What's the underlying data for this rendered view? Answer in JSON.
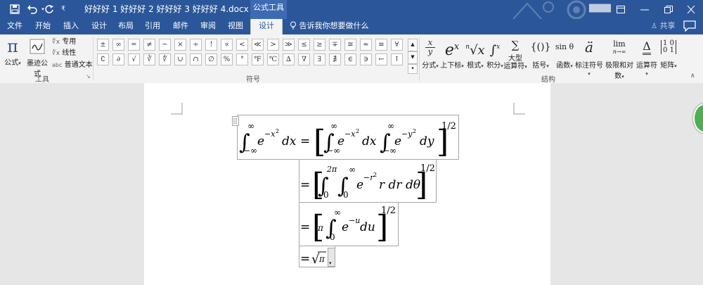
{
  "title_bar": {
    "document_title": "好好好 1 好好好 2 好好好 3 好好好 4.docx - Word",
    "context_tab": "公式工具",
    "user": "████",
    "quick_access": [
      "save-icon",
      "undo-icon",
      "redo-icon",
      "customize-icon"
    ],
    "window_controls": [
      "ribbon-display-icon",
      "minimize-icon",
      "restore-icon",
      "close-icon"
    ]
  },
  "tabs": [
    "文件",
    "开始",
    "插入",
    "设计",
    "布局",
    "引用",
    "邮件",
    "审阅",
    "视图",
    "设计"
  ],
  "active_tab_index": 9,
  "tell_me": "告诉我你想要做什么",
  "share": "共享",
  "tools_group": {
    "label": "工具",
    "formula_button": "公式",
    "ink_button": "墨迹公式",
    "small_buttons": [
      "专用",
      "线性",
      "普通文本"
    ],
    "abc_prefix": "abc"
  },
  "symbols_group": {
    "label": "符号",
    "row1": [
      "±",
      "∞",
      "=",
      "≠",
      "~",
      "×",
      "÷",
      "!",
      "∝",
      "<",
      "≪",
      ">",
      "≫",
      "≤",
      "≥",
      "∓",
      "≅",
      "≈",
      "≡",
      "∀"
    ],
    "row2": [
      "∁",
      "∂",
      "√",
      "∛",
      "∜",
      "∪",
      "∩",
      "∅",
      "%",
      "°",
      "℉",
      "℃",
      "∆",
      "∇",
      "∃",
      "∄",
      "∈",
      "∋",
      "←",
      "↑"
    ]
  },
  "structures_group": {
    "label": "结构",
    "buttons": [
      {
        "icon": "x/y",
        "label": "分式"
      },
      {
        "icon": "eˣ",
        "label": "上下标"
      },
      {
        "icon": "ⁿ√x",
        "label": "根式"
      },
      {
        "icon": "∫",
        "label": "积分"
      },
      {
        "icon": "∑",
        "label": "大型\n运算符"
      },
      {
        "icon": "{()}",
        "label": "括号"
      },
      {
        "icon": "sinθ",
        "label": "函数"
      },
      {
        "icon": "ä",
        "label": "标注符号"
      },
      {
        "icon": "lim",
        "label": "极限和对数"
      },
      {
        "icon": "Δ",
        "label": "运算符"
      },
      {
        "icon": "[10/01]",
        "label": "矩阵"
      }
    ]
  }
}
